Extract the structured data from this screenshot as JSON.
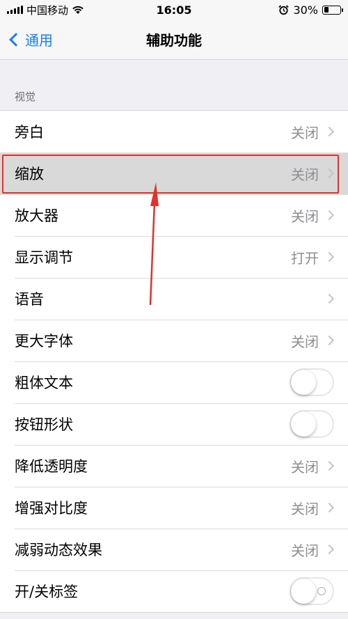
{
  "statusbar": {
    "carrier": "中国移动",
    "time": "16:05",
    "battery": "30%",
    "battery_level": 0.3
  },
  "navbar": {
    "back_label": "通用",
    "title": "辅助功能"
  },
  "section": {
    "header": "视觉"
  },
  "rows": [
    {
      "label": "旁白",
      "value": "关闭",
      "type": "disclosure"
    },
    {
      "label": "缩放",
      "value": "关闭",
      "type": "disclosure",
      "highlighted": true
    },
    {
      "label": "放大器",
      "value": "关闭",
      "type": "disclosure"
    },
    {
      "label": "显示调节",
      "value": "打开",
      "type": "disclosure"
    },
    {
      "label": "语音",
      "value": "",
      "type": "disclosure"
    },
    {
      "label": "更大字体",
      "value": "关闭",
      "type": "disclosure"
    },
    {
      "label": "粗体文本",
      "type": "toggle",
      "on": false
    },
    {
      "label": "按钮形状",
      "type": "toggle",
      "on": false
    },
    {
      "label": "降低透明度",
      "value": "关闭",
      "type": "disclosure"
    },
    {
      "label": "增强对比度",
      "value": "关闭",
      "type": "disclosure"
    },
    {
      "label": "减弱动态效果",
      "value": "关闭",
      "type": "disclosure"
    },
    {
      "label": "开/关标签",
      "type": "toggle",
      "on": false
    }
  ],
  "colors": {
    "accent": "#1a7cf5",
    "annotation": "#e4302b",
    "background": "#efeff4"
  }
}
